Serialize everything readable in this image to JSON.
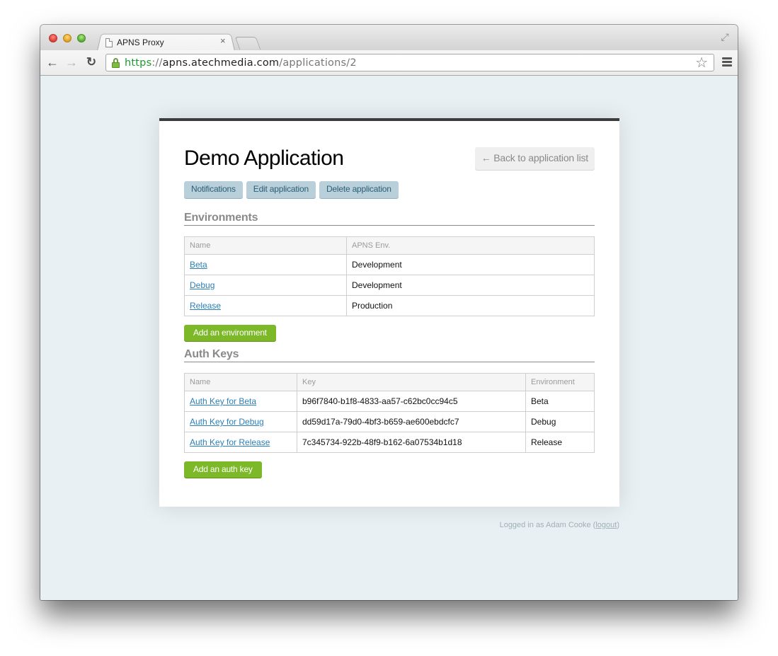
{
  "browser": {
    "tab_title": "APNS Proxy",
    "tab_close_glyph": "×",
    "url": {
      "scheme": "https",
      "separator": "://",
      "host": "apns.atechmedia.com",
      "path": "/applications/2"
    },
    "icons": {
      "back": "←",
      "forward": "→",
      "reload": "↻",
      "star": "☆",
      "fullscreen": "⤢"
    }
  },
  "page": {
    "title": "Demo Application",
    "back_link": "← Back to application list",
    "actions": [
      {
        "label": "Notifications"
      },
      {
        "label": "Edit application"
      },
      {
        "label": "Delete application"
      }
    ],
    "environments": {
      "heading": "Environments",
      "columns": [
        "Name",
        "APNS Env."
      ],
      "rows": [
        {
          "name": "Beta",
          "apns_env": "Development"
        },
        {
          "name": "Debug",
          "apns_env": "Development"
        },
        {
          "name": "Release",
          "apns_env": "Production"
        }
      ],
      "add_button": "Add an environment"
    },
    "auth_keys": {
      "heading": "Auth Keys",
      "columns": [
        "Name",
        "Key",
        "Environment"
      ],
      "rows": [
        {
          "name": "Auth Key for Beta",
          "key": "b96f7840-b1f8-4833-aa57-c62bc0cc94c5",
          "environment": "Beta"
        },
        {
          "name": "Auth Key for Debug",
          "key": "dd59d17a-79d0-4bf3-b659-ae600ebdcfc7",
          "environment": "Debug"
        },
        {
          "name": "Auth Key for Release",
          "key": "7c345734-922b-48f9-b162-6a07534b1d18",
          "environment": "Release"
        }
      ],
      "add_button": "Add an auth key"
    },
    "footer": {
      "logged_in_prefix": "Logged in as Adam Cooke (",
      "logout_label": "logout",
      "logged_in_suffix": ")"
    }
  },
  "colors": {
    "page_background": "#e9f0f3",
    "card_top_border": "#3c3c3c",
    "action_button_bg": "#b9d0db",
    "action_button_text": "#2b5e78",
    "primary_green": "#7cb827",
    "link_blue": "#2a7fb8",
    "url_scheme_green": "#1e9a2d"
  }
}
